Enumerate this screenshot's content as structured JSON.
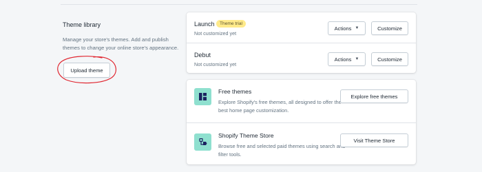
{
  "library": {
    "title": "Theme library",
    "description": "Manage your store's themes. Add and publish themes to change your online store's appearance.",
    "upload_label": "Upload theme"
  },
  "themes": [
    {
      "name": "Launch",
      "badge": "Theme trial",
      "status": "Not customized yet",
      "actions_label": "Actions",
      "customize_label": "Customize"
    },
    {
      "name": "Debut",
      "badge": "",
      "status": "Not customized yet",
      "actions_label": "Actions",
      "customize_label": "Customize"
    }
  ],
  "stores": [
    {
      "title": "Free themes",
      "description": "Explore Shopify's free themes, all designed to offer the best home page customization.",
      "button_label": "Explore free themes",
      "icon": "layout-blocks-icon"
    },
    {
      "title": "Shopify Theme Store",
      "description": "Browse free and selected paid themes using search and filter tools.",
      "button_label": "Visit Theme Store",
      "icon": "store-tag-icon"
    }
  ],
  "colors": {
    "badge_bg": "#ffea8a",
    "icon_bg": "#8fe0cf",
    "annotation": "#e0242e"
  }
}
